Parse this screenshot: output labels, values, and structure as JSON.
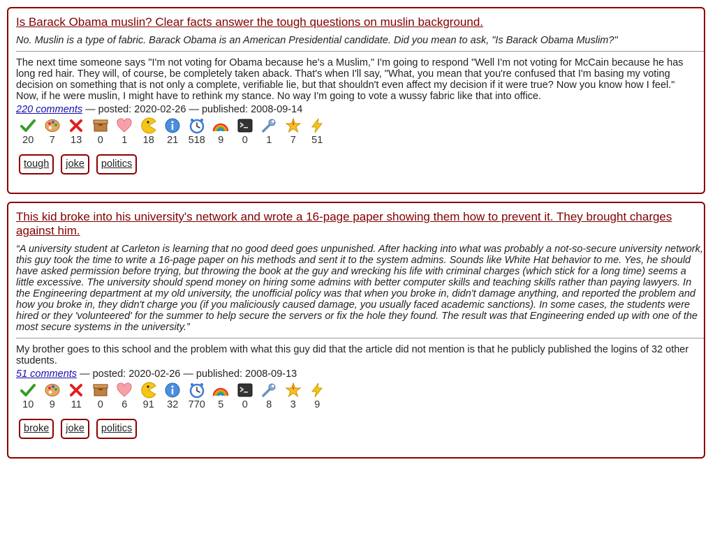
{
  "posts": [
    {
      "title": "Is Barack Obama muslin? Clear facts answer the tough questions on muslin background.",
      "summary": "No. Muslin is a type of fabric. Barack Obama is an American Presidential candidate. Did you mean to ask, \"Is Barack Obama Muslim?\"",
      "body": "The next time someone says \"I'm not voting for Obama because he's a Muslim,\" I'm going to respond \"Well I'm not voting for McCain because he has long red hair. They will, of course, be completely taken aback. That's when I'll say, \"What, you mean that you're confused that I'm basing my voting decision on something that is not only a complete, verifiable lie, but that shouldn't even affect my decision if it were true? Now you know how I feel.\" Now, if he were muslin, I might have to rethink my stance. No way I'm going to vote a wussy fabric like that into office.",
      "comments": "220 comments",
      "dates": " — posted: 2020-02-26 — published: 2008-09-14",
      "counts": [
        "20",
        "7",
        "13",
        "0",
        "1",
        "18",
        "21",
        "518",
        "9",
        "0",
        "1",
        "7",
        "51"
      ],
      "tags": [
        "tough",
        "joke",
        "politics"
      ]
    },
    {
      "title": "This kid broke into his university's network and wrote a 16-page paper showing them how to prevent it. They brought charges against him.",
      "summary": "“A university student at Carleton is learning that no good deed goes unpunished. After hacking into what was probably a not-so-secure university network, this guy took the time to write a 16-page paper on his methods and sent it to the system admins. Sounds like White Hat behavior to me. Yes, he should have asked permission before trying, but throwing the book at the guy and wrecking his life with criminal charges (which stick for a long time) seems a little excessive. The university should spend money on hiring some admins with better computer skills and teaching skills rather than paying lawyers. In the Engineering department at my old university, the unofficial policy was that when you broke in, didn't damage anything, and reported the problem and how you broke in, they didn't charge you (if you maliciously caused damage, you usually faced academic sanctions). In some cases, the students were hired or they 'volunteered' for the summer to help secure the servers or fix the hole they found. The result was that Engineering ended up with one of the most secure systems in the university.”",
      "body": "My brother goes to this school and the problem with what this guy did that the article did not mention is that he publicly published the logins of 32 other students.",
      "comments": "51 comments",
      "dates": " — posted: 2020-02-26 — published: 2008-09-13",
      "counts": [
        "10",
        "9",
        "11",
        "0",
        "6",
        "91",
        "32",
        "770",
        "5",
        "0",
        "8",
        "3",
        "9"
      ],
      "tags": [
        "broke",
        "joke",
        "politics"
      ]
    }
  ],
  "reaction_icons": [
    "check-icon",
    "palette-icon",
    "cross-icon",
    "box-icon",
    "heart-icon",
    "pacman-icon",
    "info-icon",
    "clock-icon",
    "rainbow-icon",
    "terminal-icon",
    "wrench-icon",
    "star-burst-icon",
    "lightning-icon"
  ],
  "colors": {
    "accent": "#8b0000",
    "title": "#800000",
    "link": "#1a0dab"
  }
}
